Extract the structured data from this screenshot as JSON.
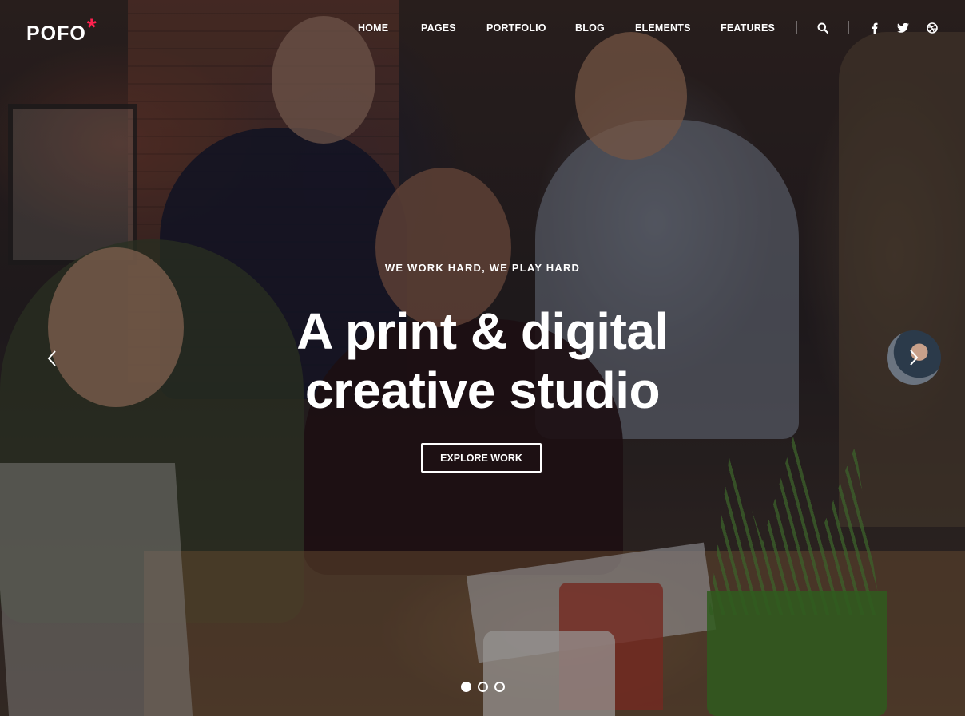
{
  "brand": {
    "name": "POFO",
    "mark": "*",
    "accent_color": "#ff214f"
  },
  "nav": {
    "items": [
      {
        "label": "HOME"
      },
      {
        "label": "PAGES"
      },
      {
        "label": "PORTFOLIO"
      },
      {
        "label": "BLOG"
      },
      {
        "label": "ELEMENTS"
      },
      {
        "label": "FEATURES"
      }
    ],
    "icons": [
      "search-icon",
      "facebook-icon",
      "twitter-icon",
      "dribbble-icon"
    ]
  },
  "hero": {
    "tagline": "WE WORK HARD, WE PLAY HARD",
    "headline_line1": "A print & digital",
    "headline_line2": "creative studio",
    "cta_label": "EXPLORE WORK",
    "slides_total": 3,
    "active_slide": 1
  }
}
